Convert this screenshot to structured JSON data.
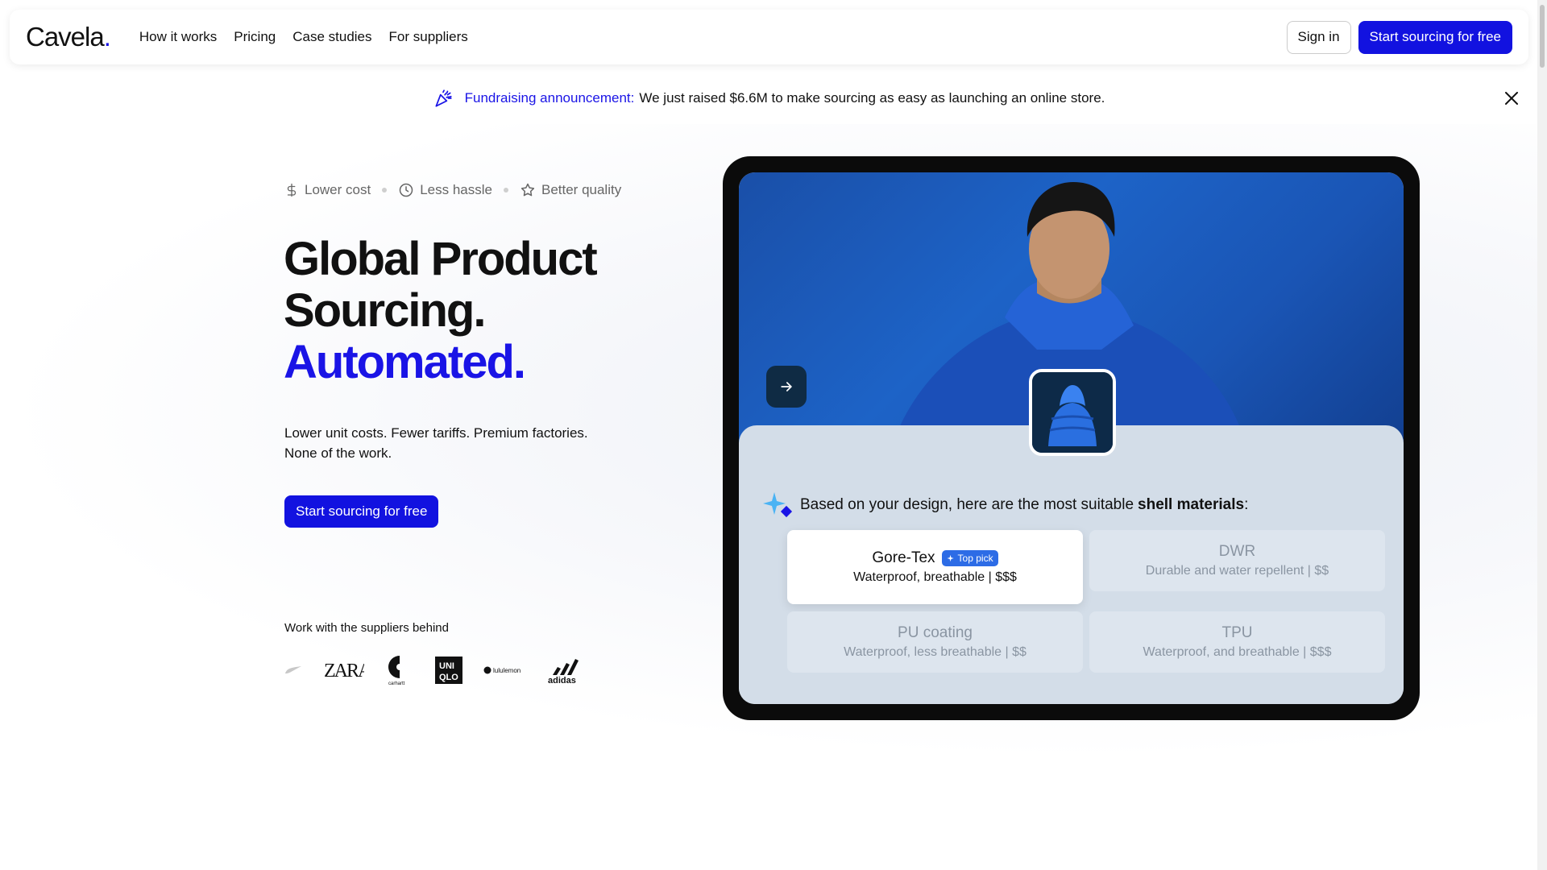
{
  "nav": {
    "logo": "Cavela",
    "logo_dot": ".",
    "links": [
      "How it works",
      "Pricing",
      "Case studies",
      "For suppliers"
    ],
    "sign_in": "Sign in",
    "cta": "Start sourcing for free"
  },
  "announcement": {
    "label": "Fundraising announcement:",
    "text": "We just raised $6.6M to make sourcing as easy as launching an online store."
  },
  "benefits": [
    "Lower cost",
    "Less hassle",
    "Better quality"
  ],
  "hero": {
    "line1": "Global Product",
    "line2": "Sourcing.",
    "line3": "Automated.",
    "sub1": "Lower unit costs. Fewer tariffs. Premium factories.",
    "sub2": "None of the work.",
    "cta": "Start sourcing for free"
  },
  "suppliers": {
    "label": "Work with the suppliers behind",
    "brands": [
      "Nike",
      "ZARA",
      "carhartt",
      "UNIQLO",
      "lululemon",
      "adidas"
    ]
  },
  "panel": {
    "intro": "Based on your design, here are the most suitable",
    "emphasis": "shell materials",
    "colon": ":",
    "top_pick": "Top pick",
    "materials": [
      {
        "name": "Gore-Tex",
        "desc": "Waterproof, breathable  |  $$$"
      },
      {
        "name": "DWR",
        "desc": "Durable and water repellent  |  $$"
      },
      {
        "name": "PU coating",
        "desc": "Waterproof, less breathable  |  $$"
      },
      {
        "name": "TPU",
        "desc": "Waterproof, and breathable  |  $$$"
      }
    ]
  },
  "colors": {
    "accent": "#1a14e6",
    "primary_button": "#1212e0",
    "photo_blue": "#1d63c7",
    "panel_bg": "#d3dde8"
  },
  "icons": [
    "party-popper-icon",
    "close-icon",
    "dollar-icon",
    "clock-icon",
    "star-icon",
    "arrow-right-icon",
    "sparkle-icon"
  ]
}
